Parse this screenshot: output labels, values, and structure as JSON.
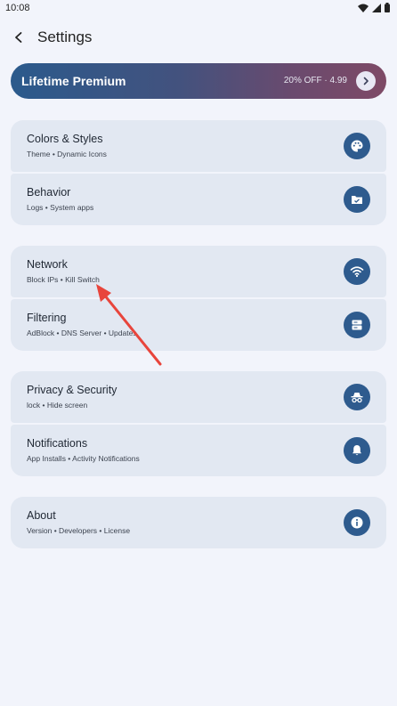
{
  "status_bar": {
    "time": "10:08",
    "icons": [
      "wifi-icon",
      "signal-icon",
      "battery-icon"
    ]
  },
  "app_bar": {
    "title": "Settings"
  },
  "premium": {
    "title": "Lifetime Premium",
    "offer": "20% OFF · 4.99"
  },
  "groups": [
    {
      "items": [
        {
          "title": "Colors & Styles",
          "subtitle": "Theme • Dynamic Icons",
          "icon": "palette-icon"
        },
        {
          "title": "Behavior",
          "subtitle": "Logs • System apps",
          "icon": "folder-icon"
        }
      ]
    },
    {
      "items": [
        {
          "title": "Network",
          "subtitle": "Block IPs • Kill Switch",
          "icon": "wifi-icon"
        },
        {
          "title": "Filtering",
          "subtitle": "AdBlock • DNS Server • Updates",
          "icon": "server-icon"
        }
      ]
    },
    {
      "items": [
        {
          "title": "Privacy & Security",
          "subtitle": "lock • Hide screen",
          "icon": "incognito-icon"
        },
        {
          "title": "Notifications",
          "subtitle": "App Installs • Activity Notifications",
          "icon": "bell-icon"
        }
      ]
    },
    {
      "items": [
        {
          "title": "About",
          "subtitle": "Version • Developers • License",
          "icon": "info-icon"
        }
      ]
    }
  ],
  "colors": {
    "accent": "#2e5b8e",
    "card": "#e2e8f2",
    "background": "#f2f4fb",
    "annotation": "#e8453c"
  }
}
